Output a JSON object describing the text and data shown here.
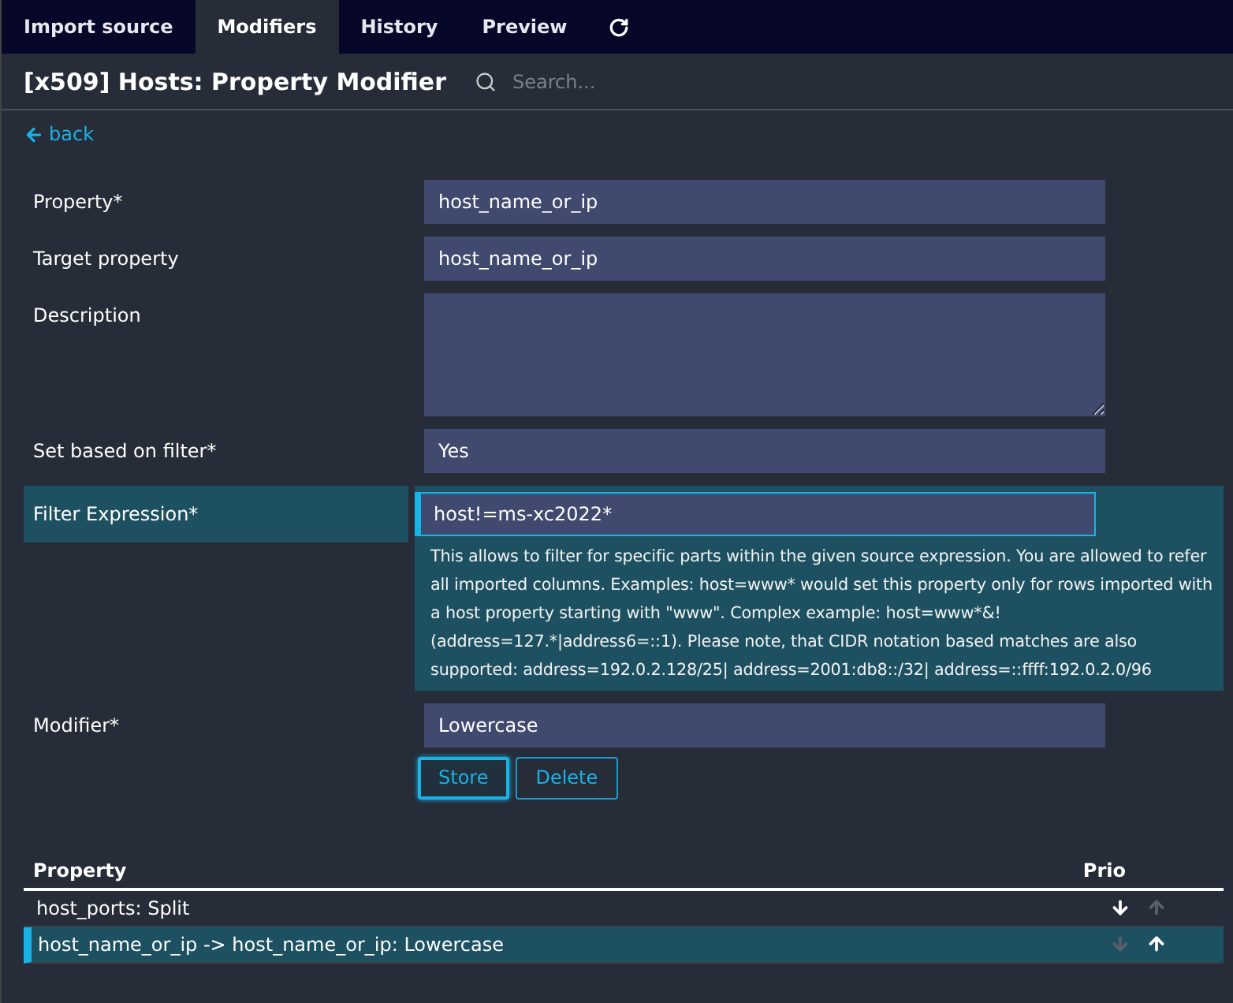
{
  "tabs": [
    {
      "label": "Import source",
      "selected": false
    },
    {
      "label": "Modifiers",
      "selected": true
    },
    {
      "label": "History",
      "selected": false
    },
    {
      "label": "Preview",
      "selected": false
    }
  ],
  "title": "[x509] Hosts: Property Modifier",
  "search": {
    "placeholder": "Search..."
  },
  "back": "back",
  "fields": [
    {
      "label": "Property*",
      "kind": "input",
      "value": "host_name_or_ip",
      "active": false
    },
    {
      "label": "Target property",
      "kind": "input",
      "value": "host_name_or_ip",
      "active": false
    },
    {
      "label": "Description",
      "kind": "textarea",
      "active": false
    },
    {
      "label": "Set based on filter*",
      "kind": "select",
      "value": "Yes",
      "active": false
    },
    {
      "label": "Filter Expression*",
      "kind": "input",
      "value": "host!=ms-xc2022*",
      "active": true,
      "hint": "This allows to filter for specific parts within the given source expression. You are allowed to refer all imported columns. Examples: host=www* would set this property only for rows imported with a host property starting with \"www\". Complex example: host=www*&!(address=127.*|address6=::1). Please note, that CIDR notation based matches are also supported: address=192.0.2.128/25| address=2001:db8::/32| address=::ffff:192.0.2.0/96"
    },
    {
      "label": "Modifier*",
      "kind": "select",
      "value": "Lowercase",
      "active": false
    }
  ],
  "buttons": [
    {
      "label": "Store",
      "focused": true
    },
    {
      "label": "Delete",
      "focused": false
    }
  ],
  "table": {
    "columns": [
      "Property",
      "Prio"
    ],
    "rows": [
      {
        "text": "host_ports: Split",
        "selected": false,
        "down_enabled": true,
        "up_enabled": false
      },
      {
        "text": "host_name_or_ip -> host_name_or_ip: Lowercase",
        "selected": true,
        "down_enabled": false,
        "up_enabled": true
      }
    ]
  }
}
